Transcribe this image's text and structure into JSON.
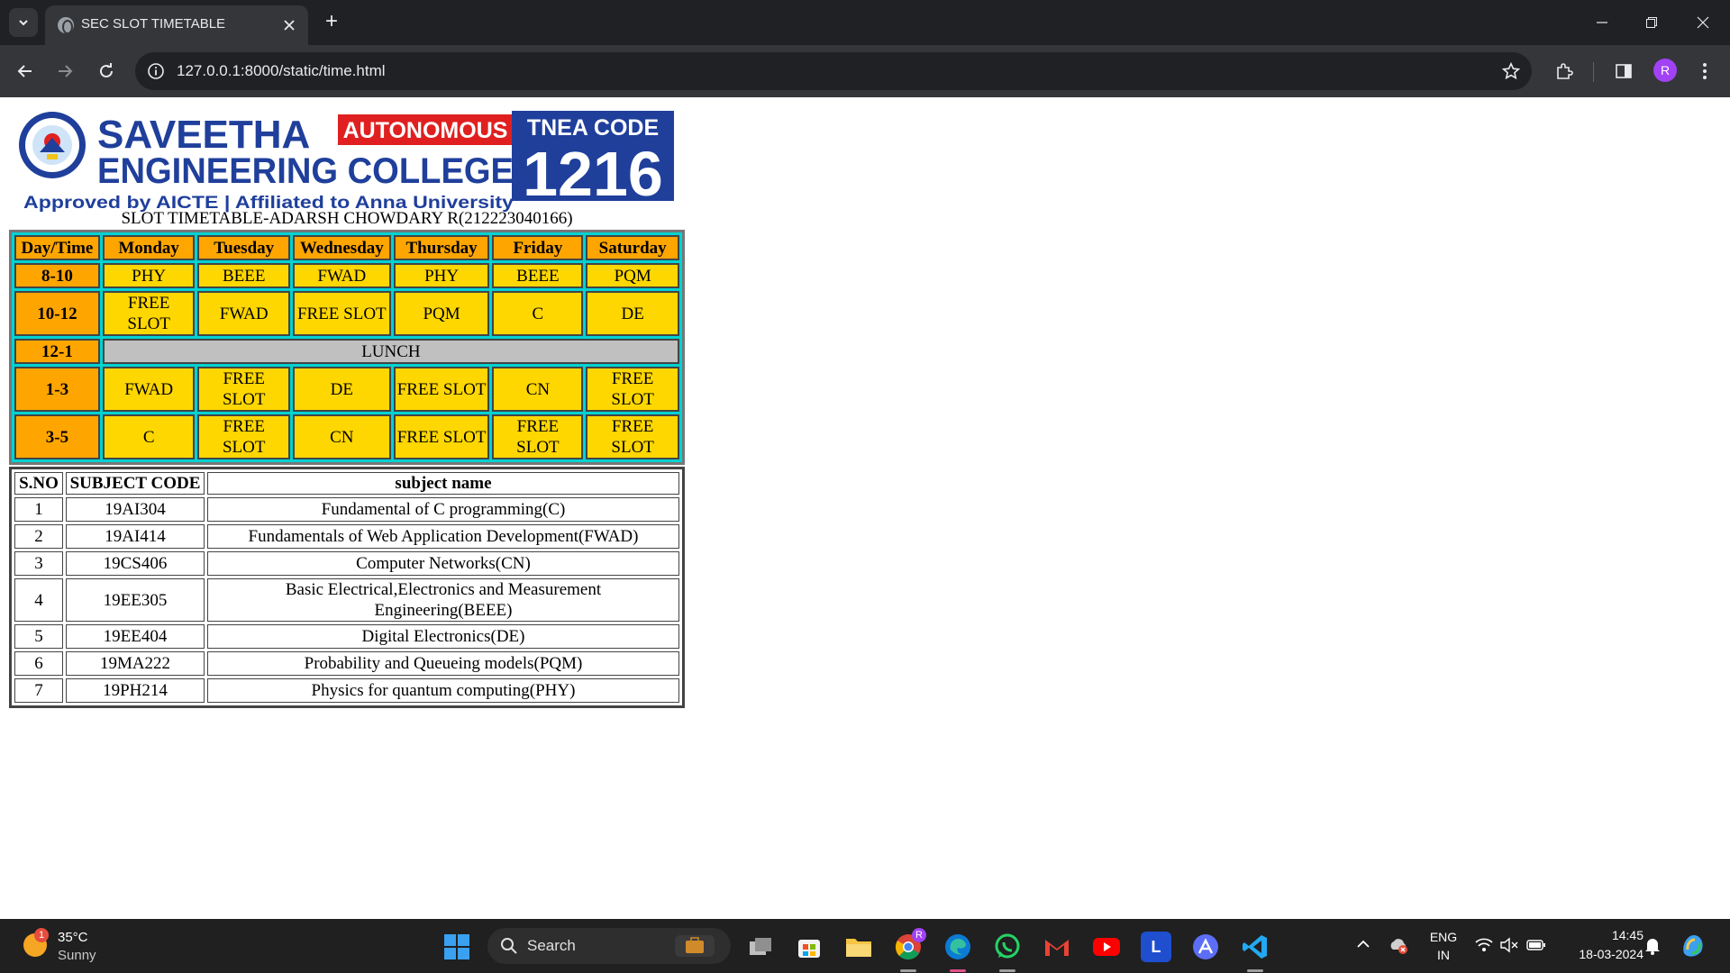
{
  "browser": {
    "tab_title": "SEC SLOT TIMETABLE",
    "new_tab": "+",
    "url": "127.0.0.1:8000/static/time.html",
    "profile_initial": "R"
  },
  "page": {
    "logo": {
      "line1": "SAVEETHA",
      "badge": "AUTONOMOUS",
      "line2": "ENGINEERING COLLEGE",
      "line3": "Approved by AICTE  |  Affiliated to Anna University",
      "tnea_label": "TNEA CODE",
      "tnea_code": "1216",
      "colors": {
        "blue": "#1f3f9b",
        "red": "#e02020"
      }
    },
    "heading": "SLOT TIMETABLE-ADARSH CHOWDARY R(212223040166)",
    "timetable": {
      "header": [
        "Day/Time",
        "Monday",
        "Tuesday",
        "Wednesday",
        "Thursday",
        "Friday",
        "Saturday"
      ],
      "rows": [
        {
          "time": "8-10",
          "cells": [
            "PHY",
            "BEEE",
            "FWAD",
            "PHY",
            "BEEE",
            "PQM"
          ]
        },
        {
          "time": "10-12",
          "cells": [
            "FREE SLOT",
            "FWAD",
            "FREE SLOT",
            "PQM",
            "C",
            "DE"
          ]
        },
        {
          "time": "12-1",
          "lunch": "LUNCH"
        },
        {
          "time": "1-3",
          "cells": [
            "FWAD",
            "FREE SLOT",
            "DE",
            "FREE SLOT",
            "CN",
            "FREE SLOT"
          ]
        },
        {
          "time": "3-5",
          "cells": [
            "C",
            "FREE SLOT",
            "CN",
            "FREE SLOT",
            "FREE SLOT",
            "FREE SLOT"
          ]
        }
      ],
      "colors": {
        "frame": "#00d2d2",
        "header": "#ffa500",
        "cell": "#ffd700",
        "lunch": "#c0c0c0"
      }
    },
    "subjects": {
      "header": [
        "S.NO",
        "SUBJECT CODE",
        "subject name"
      ],
      "rows": [
        [
          "1",
          "19AI304",
          "Fundamental of C programming(C)"
        ],
        [
          "2",
          "19AI414",
          "Fundamentals of Web Application Development(FWAD)"
        ],
        [
          "3",
          "19CS406",
          "Computer Networks(CN)"
        ],
        [
          "4",
          "19EE305",
          "Basic Electrical,Electronics and Measurement Engineering(BEEE)"
        ],
        [
          "5",
          "19EE404",
          "Digital Electronics(DE)"
        ],
        [
          "6",
          "19MA222",
          "Probability and Queueing models(PQM)"
        ],
        [
          "7",
          "19PH214",
          "Physics for quantum computing(PHY)"
        ]
      ]
    }
  },
  "taskbar": {
    "weather_badge": "1",
    "weather_temp": "35°C",
    "weather_condition": "Sunny",
    "search_label": "Search",
    "language_line1": "ENG",
    "language_line2": "IN",
    "time": "14:45",
    "date": "18-03-2024",
    "linkedin_letter": "L",
    "chrome_profile_badge": "R"
  }
}
